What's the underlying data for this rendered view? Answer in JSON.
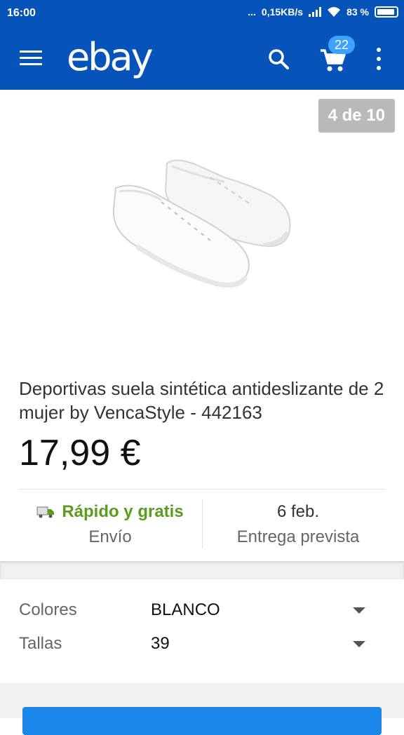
{
  "status_bar": {
    "time": "16:00",
    "dots": "...",
    "network_speed": "0,15KB/s",
    "battery": "83 %"
  },
  "app_bar": {
    "logo": "ebay",
    "cart_count": "22",
    "icons": [
      "menu-icon",
      "search-icon",
      "cart-icon",
      "more-vert-icon"
    ]
  },
  "gallery": {
    "counter": "4 de 10"
  },
  "product": {
    "title": "Deportivas suela sintética antideslizante de 2 mujer by VencaStyle - 442163",
    "price": "17,99 €"
  },
  "shipping": {
    "title": "Rápido y gratis",
    "subtitle": "Envío",
    "icon": "truck-icon"
  },
  "delivery": {
    "date": "6 feb.",
    "subtitle": "Entrega prevista"
  },
  "options": [
    {
      "label": "Colores",
      "value": "BLANCO"
    },
    {
      "label": "Tallas",
      "value": "39"
    }
  ],
  "colors": {
    "brand_blue": "#0654ba",
    "badge_blue": "#3da2ff",
    "green": "#5a9d1e",
    "button_blue": "#1a86e8"
  }
}
